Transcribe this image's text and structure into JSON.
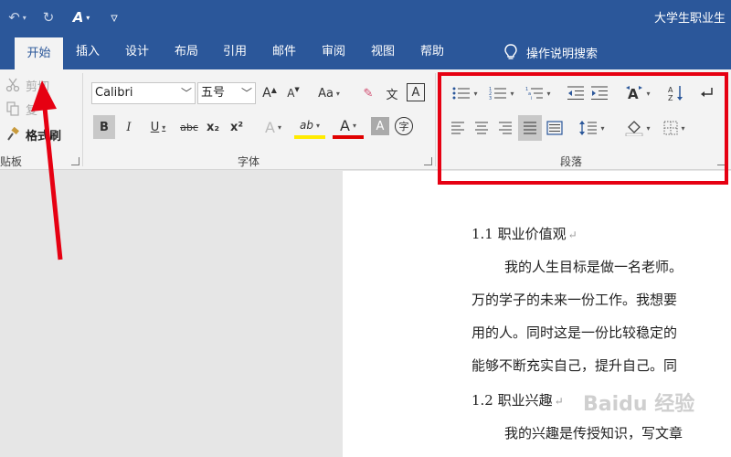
{
  "titlebar": {
    "doc_title": "大学生职业生",
    "undo_icon": "↶",
    "redo_icon": "↻",
    "spell_icon": "A",
    "customize_icon": "▿"
  },
  "tabs": [
    {
      "label": "开始",
      "active": true
    },
    {
      "label": "插入"
    },
    {
      "label": "设计"
    },
    {
      "label": "布局"
    },
    {
      "label": "引用"
    },
    {
      "label": "邮件"
    },
    {
      "label": "审阅"
    },
    {
      "label": "视图"
    },
    {
      "label": "帮助"
    }
  ],
  "tell_me": {
    "label": "操作说明搜索",
    "icon": "lightbulb-icon"
  },
  "clipboard": {
    "cut": "剪切",
    "copy": "复",
    "format_painter": "格式刷",
    "group_label": "贴板"
  },
  "font": {
    "font_name": "Calibri",
    "font_size": "五号",
    "group_label": "字体",
    "grow": "A",
    "shrink": "A",
    "case": "Aa",
    "clear": "✎",
    "phonetic": "文",
    "border_char": "A",
    "bold": "B",
    "italic": "I",
    "underline": "U",
    "strike": "abc",
    "sub": "x₂",
    "sup": "x²",
    "effects": "A",
    "highlight": "ab",
    "font_color": "A",
    "shade": "A",
    "enclose": "字"
  },
  "paragraph": {
    "group_label": "段落"
  },
  "document": {
    "lines": [
      {
        "text": "1.1 职业价值观",
        "indent": false,
        "mark": "↵"
      },
      {
        "text": "我的人生目标是做一名老师。",
        "indent": true,
        "mark": ""
      },
      {
        "text": "万的学子的未来一份工作。我想要",
        "indent": false,
        "mark": ""
      },
      {
        "text": "用的人。同时这是一份比较稳定的",
        "indent": false,
        "mark": ""
      },
      {
        "text": "能够不断充实自己，提升自己。同",
        "indent": false,
        "mark": ""
      },
      {
        "text": "1.2 职业兴趣",
        "indent": false,
        "mark": "↵"
      },
      {
        "text": "我的兴趣是传授知识，写文章",
        "indent": true,
        "mark": ""
      }
    ]
  },
  "watermark": "Baidu 经验",
  "colors": {
    "ribbon_blue": "#2b579a",
    "annotation_red": "#e60012"
  }
}
